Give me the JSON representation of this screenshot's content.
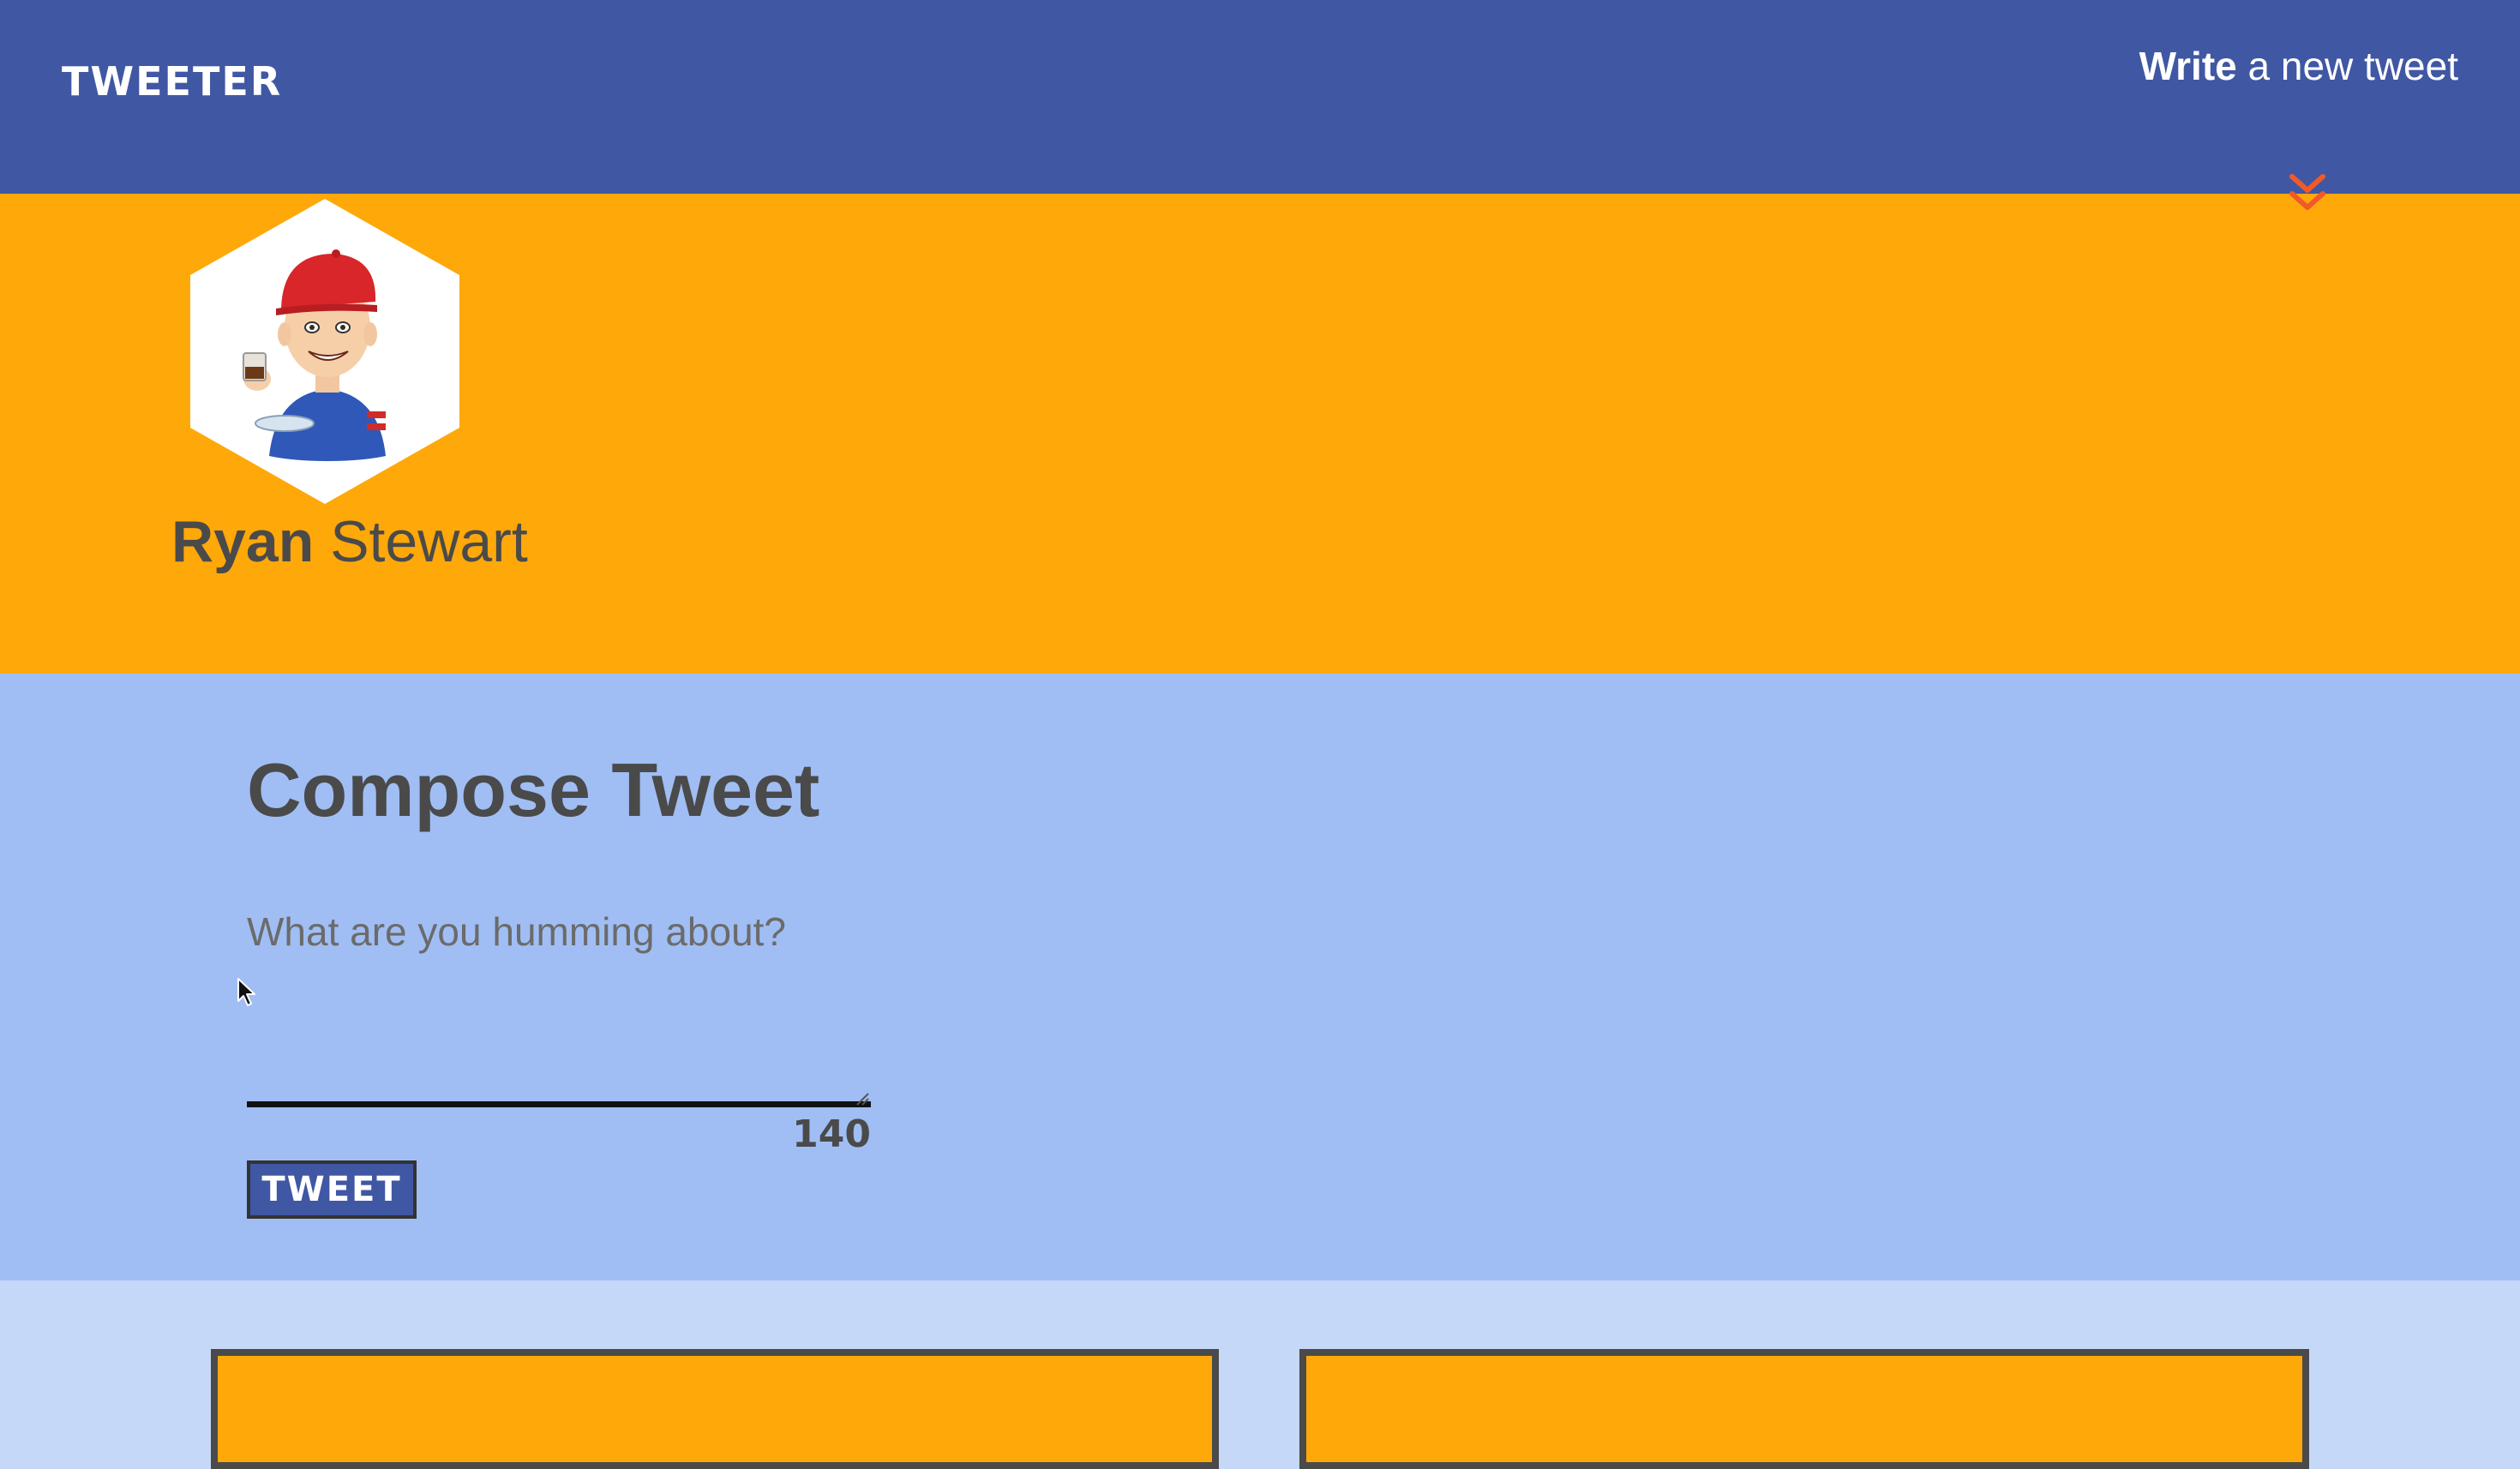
{
  "nav": {
    "logo": "TWEETER",
    "write_strong": "Write",
    "write_rest": "a new tweet",
    "chevron_icon": "double-chevron-down-icon"
  },
  "profile": {
    "first_name": "Ryan",
    "last_name": "Stewart",
    "avatar_icon": "user-avatar-hexagon"
  },
  "compose": {
    "title": "Compose Tweet",
    "placeholder": "What are you humming about?",
    "counter": "140",
    "tweet_button": "TWEET"
  },
  "colors": {
    "nav_bg": "#4057a3",
    "header_bg": "#ffa80a",
    "compose_bg": "#a0bef4",
    "tweets_bg": "#c5d8f8",
    "chevron": "#f05a28"
  }
}
